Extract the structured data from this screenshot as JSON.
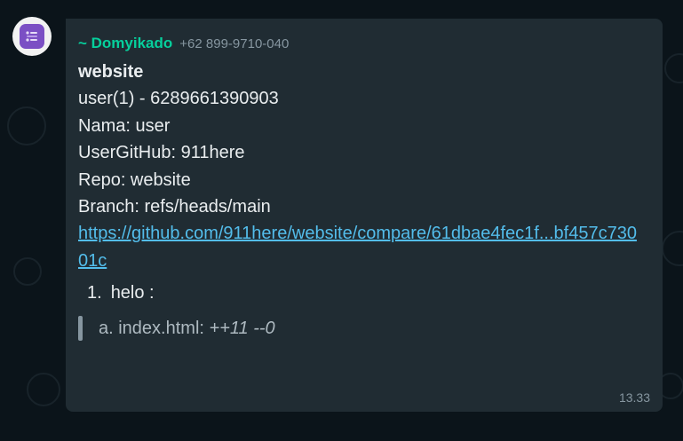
{
  "message": {
    "sender_name": "~ Domyikado",
    "sender_phone": "+62 899-9710-040",
    "lines": {
      "title": "website",
      "user": "user(1) - 6289661390903",
      "nama": "Nama: user",
      "github": "UserGitHub: 911here",
      "repo": "Repo: website",
      "branch": "Branch: refs/heads/main"
    },
    "link": "https://github.com/911here/website/compare/61dbae4fec1f...bf457c73001c",
    "list_item": {
      "number": "1.",
      "text": "helo :"
    },
    "quote": {
      "prefix": "a. index.html: ",
      "additions": "++11",
      "separator": " ",
      "deletions": "--0"
    },
    "time": "13.33"
  },
  "colors": {
    "background": "#0b141a",
    "bubble": "#202c33",
    "sender": "#06cf9c",
    "link": "#53bdeb",
    "text": "#e9edef",
    "muted": "#8696a0",
    "avatar_accent": "#7b4fc4"
  },
  "icons": {
    "avatar": "group-avatar-icon"
  }
}
